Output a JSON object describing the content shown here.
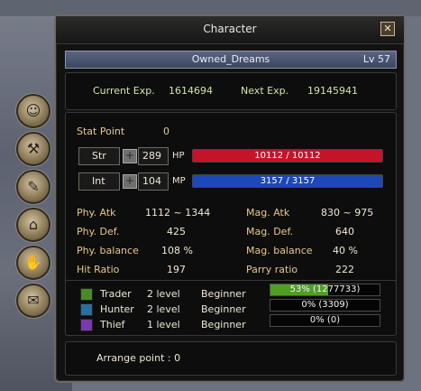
{
  "window": {
    "title": "Character"
  },
  "character": {
    "name": "Owned_Dreams",
    "level": "Lv 57"
  },
  "exp": {
    "current_label": "Current Exp.",
    "current_value": "1614694",
    "next_label": "Next Exp.",
    "next_value": "19145941"
  },
  "stat_point": {
    "label": "Stat Point",
    "value": "0"
  },
  "stats": {
    "str": {
      "label": "Str",
      "value": "289"
    },
    "int": {
      "label": "Int",
      "value": "104"
    }
  },
  "bars": {
    "hp": {
      "label": "HP",
      "text": "10112 / 10112",
      "current": 10112,
      "max": 10112,
      "color": "#c4142a"
    },
    "mp": {
      "label": "MP",
      "text": "3157 / 3157",
      "current": 3157,
      "max": 3157,
      "color": "#1d48b8"
    }
  },
  "attributes": {
    "phy_atk": {
      "label": "Phy. Atk",
      "value": "1112 ~ 1344"
    },
    "mag_atk": {
      "label": "Mag. Atk",
      "value": "830 ~ 975"
    },
    "phy_def": {
      "label": "Phy. Def.",
      "value": "425"
    },
    "mag_def": {
      "label": "Mag. Def.",
      "value": "640"
    },
    "phy_bal": {
      "label": "Phy. balance",
      "value": "108 %"
    },
    "mag_bal": {
      "label": "Mag. balance",
      "value": "40 %"
    },
    "hit": {
      "label": "Hit Ratio",
      "value": "197"
    },
    "parry": {
      "label": "Parry ratio",
      "value": "222"
    }
  },
  "jobs": [
    {
      "name": "Trader",
      "level": "2 level",
      "rank": "Beginner",
      "progress_text": "53% (1277733)",
      "progress": 0.53,
      "icon": "trader-icon",
      "color": "#4a8a2a"
    },
    {
      "name": "Hunter",
      "level": "2 level",
      "rank": "Beginner",
      "progress_text": "0% (3309)",
      "progress": 0,
      "icon": "hunter-icon",
      "color": "#2b6e9e"
    },
    {
      "name": "Thief",
      "level": "1 level",
      "rank": "Beginner",
      "progress_text": "0% (0)",
      "progress": 0,
      "icon": "thief-icon",
      "color": "#7a3aa8"
    }
  ],
  "arrange": {
    "label": "Arrange point : 0"
  },
  "side_buttons": [
    "character-tab-icon",
    "equipment-tab-icon",
    "skills-tab-icon",
    "boots-tab-icon",
    "handshake-tab-icon",
    "scroll-tab-icon"
  ]
}
